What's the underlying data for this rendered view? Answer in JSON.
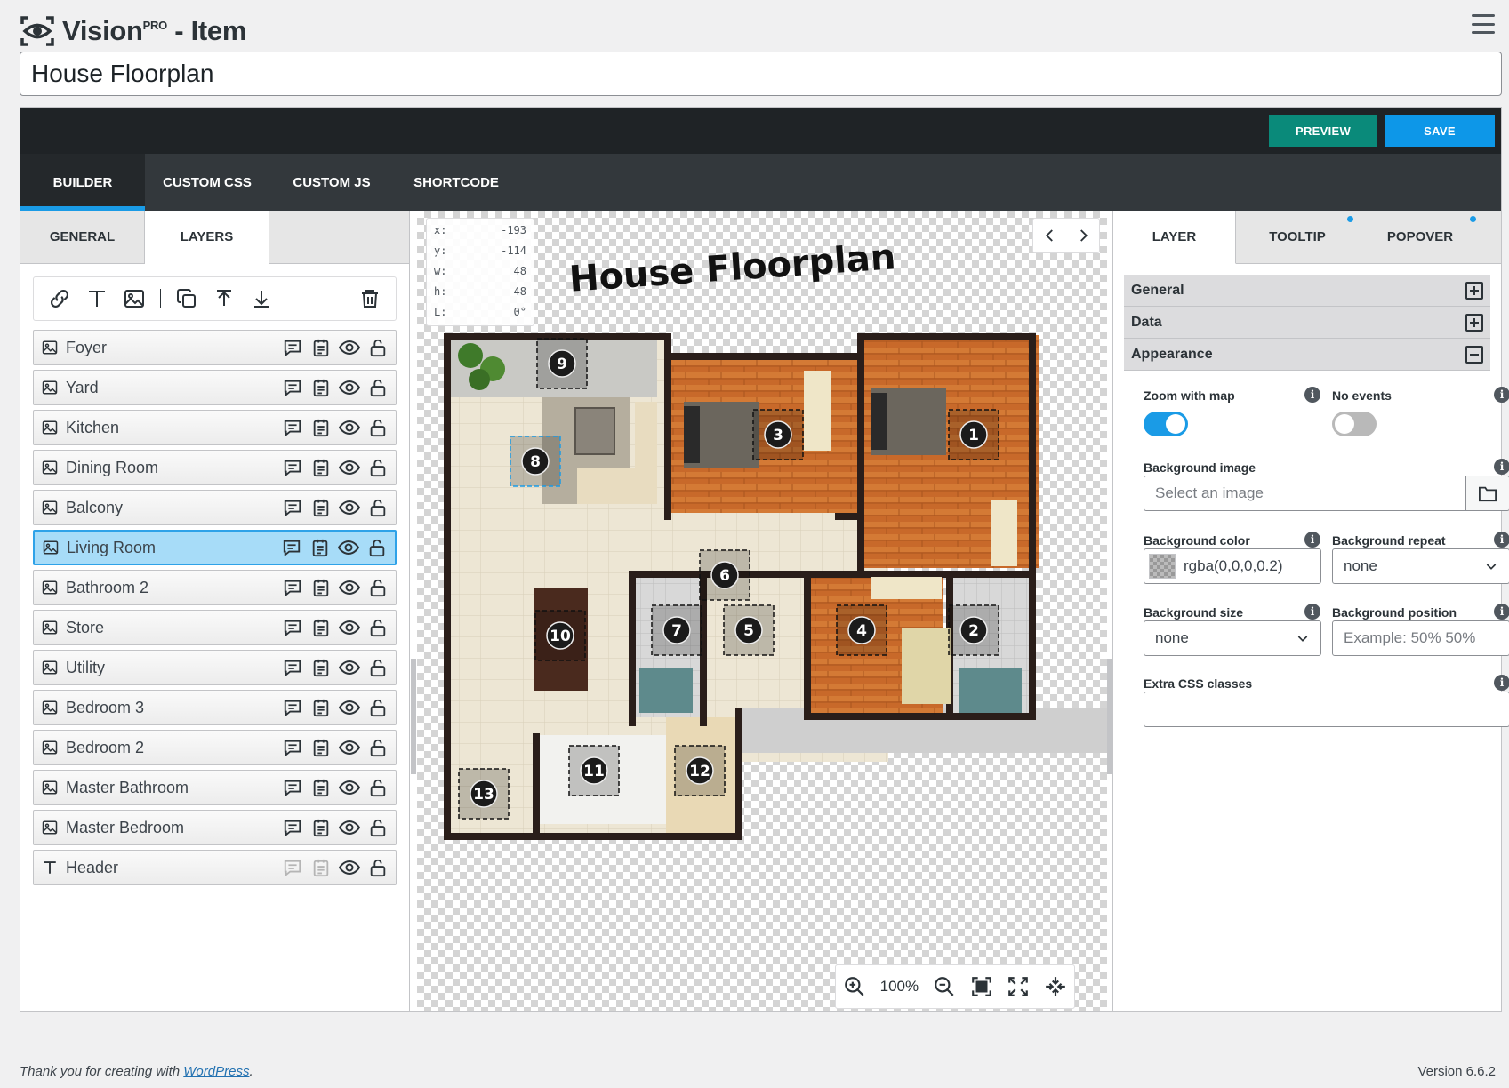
{
  "header": {
    "app_name": "Vision",
    "app_sup": "PRO",
    "app_suffix": " - Item"
  },
  "item_title": "House Floorplan",
  "topbar": {
    "preview_label": "PREVIEW",
    "save_label": "SAVE"
  },
  "main_tabs": [
    "BUILDER",
    "CUSTOM CSS",
    "CUSTOM JS",
    "SHORTCODE"
  ],
  "left_tabs": [
    "GENERAL",
    "LAYERS"
  ],
  "layers": [
    {
      "name": "Foyer",
      "type": "image",
      "selected": false
    },
    {
      "name": "Yard",
      "type": "image",
      "selected": false
    },
    {
      "name": "Kitchen",
      "type": "image",
      "selected": false
    },
    {
      "name": "Dining Room",
      "type": "image",
      "selected": false
    },
    {
      "name": "Balcony",
      "type": "image",
      "selected": false
    },
    {
      "name": "Living Room",
      "type": "image",
      "selected": true
    },
    {
      "name": "Bathroom 2",
      "type": "image",
      "selected": false
    },
    {
      "name": "Store",
      "type": "image",
      "selected": false
    },
    {
      "name": "Utility",
      "type": "image",
      "selected": false
    },
    {
      "name": "Bedroom 3",
      "type": "image",
      "selected": false
    },
    {
      "name": "Bedroom 2",
      "type": "image",
      "selected": false
    },
    {
      "name": "Master Bathroom",
      "type": "image",
      "selected": false
    },
    {
      "name": "Master Bedroom",
      "type": "image",
      "selected": false
    },
    {
      "name": "Header",
      "type": "text",
      "selected": false
    }
  ],
  "coords": {
    "x_label": "x:",
    "x": "-193",
    "y_label": "y:",
    "y": "-114",
    "w_label": "w:",
    "w": "48",
    "h_label": "h:",
    "h": "48",
    "l_label": "L:",
    "l": "0°"
  },
  "canvas": {
    "heading": "House Floorplan",
    "zoom": "100%",
    "markers": [
      "1",
      "2",
      "3",
      "4",
      "5",
      "6",
      "7",
      "8",
      "9",
      "10",
      "11",
      "12",
      "13"
    ]
  },
  "right_tabs": [
    "LAYER",
    "TOOLTIP",
    "POPOVER"
  ],
  "sections": [
    "General",
    "Data",
    "Appearance"
  ],
  "fields": {
    "zoom_with_map": "Zoom with map",
    "no_events": "No events",
    "bg_image": "Background image",
    "bg_image_placeholder": "Select an image",
    "bg_color": "Background color",
    "bg_color_value": "rgba(0,0,0,0.2)",
    "bg_repeat": "Background repeat",
    "bg_repeat_value": "none",
    "bg_size": "Background size",
    "bg_size_value": "none",
    "bg_position": "Background position",
    "bg_position_placeholder": "Example: 50% 50%",
    "extra_css": "Extra CSS classes"
  },
  "footer": {
    "thanks": "Thank you for creating with ",
    "link": "WordPress",
    "period": ".",
    "version": "Version 6.6.2"
  },
  "colors": {
    "accent": "#1a9be6",
    "preview": "#0a8a7a",
    "topbar": "#1f2326"
  }
}
